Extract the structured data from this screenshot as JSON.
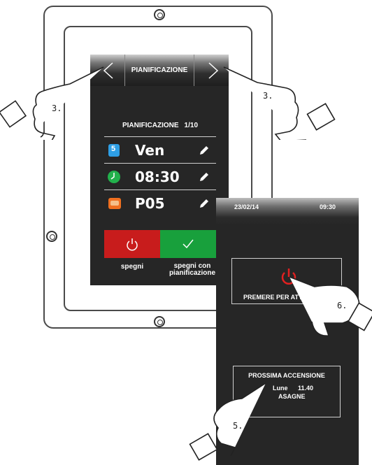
{
  "screen1": {
    "header": {
      "title": "PIANIFICAZIONE"
    },
    "card": {
      "title": "PIANIFICAZIONE",
      "page": "1/10",
      "rows": [
        {
          "value": "Ven",
          "icon": "calendar-day-icon"
        },
        {
          "value": "08:30",
          "icon": "clock-icon"
        },
        {
          "value": "P05",
          "icon": "program-icon"
        }
      ]
    },
    "buttons": {
      "off_label": "spegni",
      "off_schedule_label_1": "spegni con",
      "off_schedule_label_2": "pianificazione"
    }
  },
  "screen2": {
    "date": "23/02/14",
    "time": "09:30",
    "activate_label": "PREMERE PER ATTIV",
    "next_title": "PROSSIMA ACCENSIONE",
    "next_line1": "Lune",
    "next_line1b": "11.40",
    "next_line2": "ASAGNE"
  },
  "steps": {
    "s3a": "3.",
    "s3b": "3.",
    "s6": "6.",
    "s5": "5."
  },
  "colors": {
    "red": "#c81c1c",
    "green": "#18a03c",
    "screen": "#262626"
  }
}
